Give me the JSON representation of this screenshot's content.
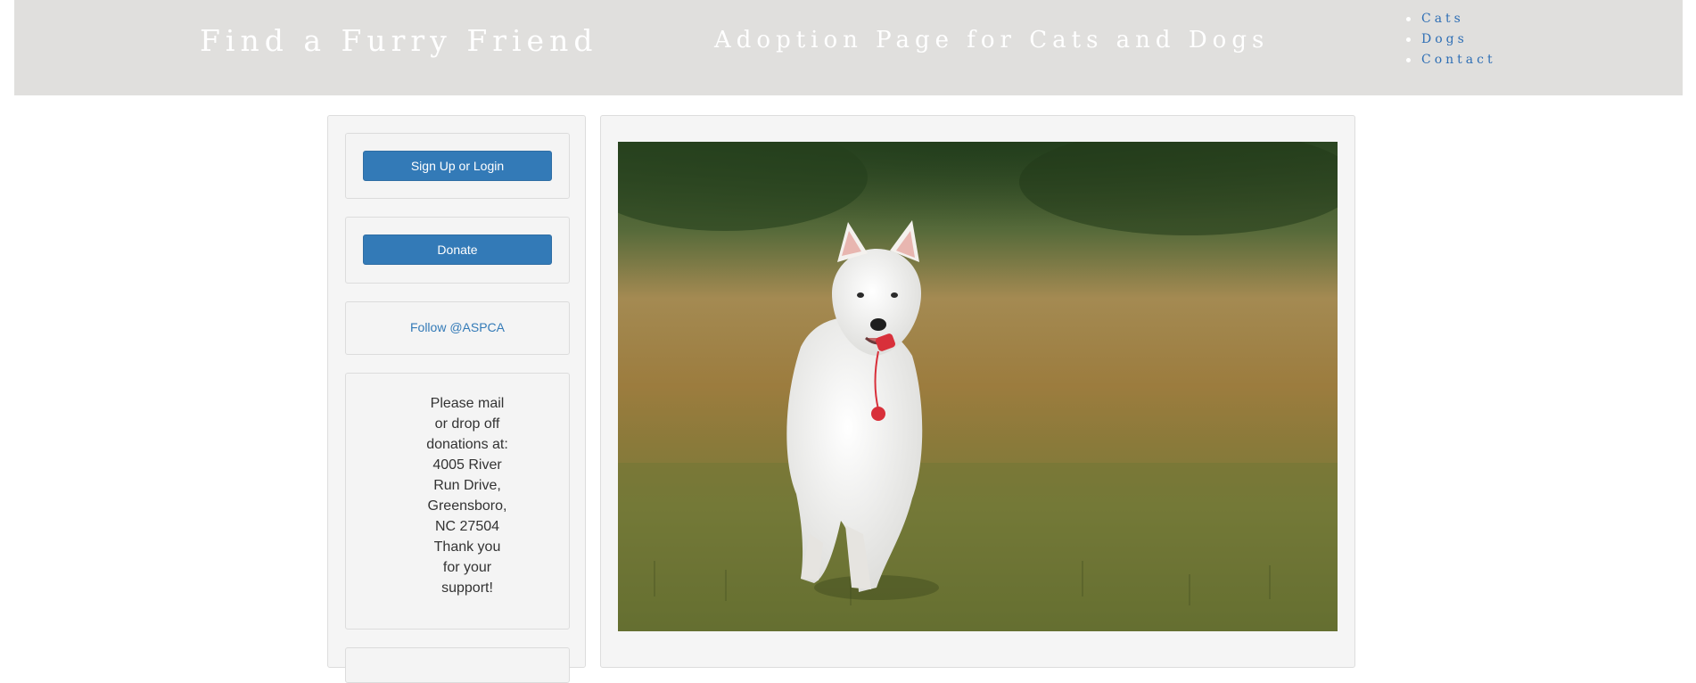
{
  "header": {
    "title": "Find a Furry Friend",
    "subtitle": "Adoption Page for Cats and Dogs",
    "nav": [
      "Cats",
      "Dogs",
      "Contact"
    ]
  },
  "sidebar": {
    "signup_label": "Sign Up or Login",
    "donate_label": "Donate",
    "follow_label": "Follow @ASPCA",
    "address_lines": [
      "Please mail",
      "or drop off",
      "donations at:",
      "4005 River",
      "Run Drive,",
      "Greensboro,",
      "NC 27504",
      "Thank you",
      "for your",
      "support!"
    ]
  },
  "colors": {
    "header_bg": "#e0dfdd",
    "button_bg": "#337ab7",
    "link": "#337ab7",
    "nav_link": "#2f6fb5"
  },
  "hero_image": {
    "subject": "white dog running on grass carrying a red toy"
  }
}
